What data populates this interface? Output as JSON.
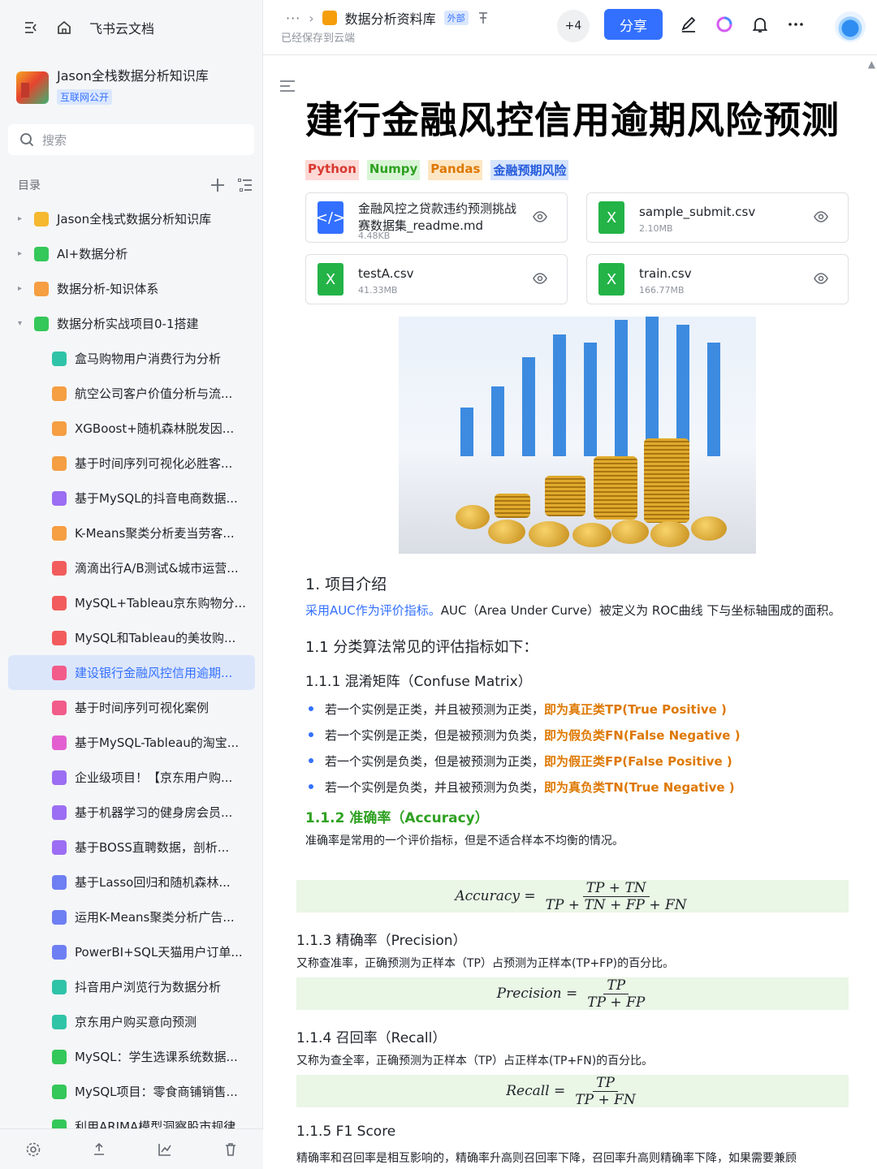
{
  "sidebar": {
    "brand": "飞书云文档",
    "space": {
      "name": "Jason全栈数据分析知识库",
      "tag": "互联网公开"
    },
    "search_placeholder": "搜索",
    "toc_label": "目录",
    "tree": [
      {
        "label": "Jason全栈式数据分析知识库",
        "level": 0,
        "icon_color": "#f5b82e",
        "expanded": false
      },
      {
        "label": "AI+数据分析",
        "level": 0,
        "icon_color": "#34c759",
        "expanded": false
      },
      {
        "label": "数据分析-知识体系",
        "level": 0,
        "icon_color": "#f59e42",
        "expanded": false
      },
      {
        "label": "数据分析实战项目0-1搭建",
        "level": 0,
        "icon_color": "#34c759",
        "expanded": true
      },
      {
        "label": "盒马购物用户消费行为分析",
        "level": 1,
        "icon_color": "#2fc3a8"
      },
      {
        "label": "航空公司客户价值分析与流...",
        "level": 1,
        "icon_color": "#f59e42"
      },
      {
        "label": "XGBoost+随机森林脱发因...",
        "level": 1,
        "icon_color": "#f59e42"
      },
      {
        "label": "基于时间序列可视化必胜客...",
        "level": 1,
        "icon_color": "#f59e42"
      },
      {
        "label": "基于MySQL的抖音电商数据...",
        "level": 1,
        "icon_color": "#9b6ef3"
      },
      {
        "label": "K-Means聚类分析麦当劳客...",
        "level": 1,
        "icon_color": "#f59e42"
      },
      {
        "label": "滴滴出行A/B测试&城市运营...",
        "level": 1,
        "icon_color": "#f25c5c"
      },
      {
        "label": "MySQL+Tableau京东购物分...",
        "level": 1,
        "icon_color": "#f25c5c"
      },
      {
        "label": "MySQL和Tableau的美妆购...",
        "level": 1,
        "icon_color": "#f25c5c"
      },
      {
        "label": "建设银行金融风控信用逾期...",
        "level": 1,
        "icon_color": "#f25c8a",
        "active": true
      },
      {
        "label": "基于时间序列可视化案例",
        "level": 1,
        "icon_color": "#f25c8a"
      },
      {
        "label": "基于MySQL-Tableau的淘宝...",
        "level": 1,
        "icon_color": "#e35fd0"
      },
      {
        "label": "企业级项目！【京东用户购...",
        "level": 1,
        "icon_color": "#9b6ef3"
      },
      {
        "label": "基于机器学习的健身房会员...",
        "level": 1,
        "icon_color": "#9b6ef3"
      },
      {
        "label": "基于BOSS直聘数据，剖析...",
        "level": 1,
        "icon_color": "#9b6ef3"
      },
      {
        "label": "基于Lasso回归和随机森林...",
        "level": 1,
        "icon_color": "#6e7ff3"
      },
      {
        "label": "运用K-Means聚类分析广告...",
        "level": 1,
        "icon_color": "#6e7ff3"
      },
      {
        "label": "PowerBI+SQL天猫用户订单...",
        "level": 1,
        "icon_color": "#6e7ff3"
      },
      {
        "label": "抖音用户浏览行为数据分析",
        "level": 1,
        "icon_color": "#2fc3a8"
      },
      {
        "label": "京东用户购买意向预测",
        "level": 1,
        "icon_color": "#2fc3a8"
      },
      {
        "label": "MySQL：学生选课系统数据...",
        "level": 1,
        "icon_color": "#34c759"
      },
      {
        "label": "MySQL项目：零食商铺销售...",
        "level": 1,
        "icon_color": "#34c759"
      },
      {
        "label": "利用ARIMA模型洞察股市规律",
        "level": 1,
        "icon_color": "#34c759"
      }
    ]
  },
  "header": {
    "breadcrumb_more": "···",
    "doc_title": "数据分析资料库",
    "external_tag": "外部",
    "saved_status": "已经保存到云端",
    "collaborators": "+4",
    "share_label": "分享"
  },
  "doc": {
    "title": "建行金融风控信用逾期风险预测",
    "tags": [
      {
        "label": "Python",
        "color": "#d83931",
        "bg": "#fdd9d6"
      },
      {
        "label": "Numpy",
        "color": "#2ea121",
        "bg": "#d9f5d6"
      },
      {
        "label": "Pandas",
        "color": "#de7802",
        "bg": "#fde6c4"
      },
      {
        "label": "金融预期风险",
        "color": "#245bdb",
        "bg": "#d6e4fd"
      }
    ],
    "files": [
      {
        "name": "金融风控之贷款违约预测挑战赛数据集_readme.md",
        "size": "4.48KB",
        "type": "code",
        "color": "#3370ff"
      },
      {
        "name": "sample_submit.csv",
        "size": "2.10MB",
        "type": "sheet",
        "color": "#23b347"
      },
      {
        "name": "testA.csv",
        "size": "41.33MB",
        "type": "sheet",
        "color": "#23b347"
      },
      {
        "name": "train.csv",
        "size": "166.77MB",
        "type": "sheet",
        "color": "#23b347"
      }
    ],
    "s1_title": "1. 项目介绍",
    "s1_link": "采用AUC作为评价指标。",
    "s1_text": "AUC（Area Under Curve）被定义为 ROC曲线 下与坐标轴围成的面积。",
    "s11_title": "1.1 分类算法常见的评估指标如下：",
    "s111_title": "1.1.1 混淆矩阵（Confuse Matrix）",
    "bullets": [
      {
        "text": "若一个实例是正类，并且被预测为正类，",
        "hl": "即为真正类TP(True Positive )"
      },
      {
        "text": "若一个实例是正类，但是被预测为负类，",
        "hl": "即为假负类FN(False Negative )"
      },
      {
        "text": "若一个实例是负类，但是被预测为正类，",
        "hl": "即为假正类FP(False Positive )"
      },
      {
        "text": "若一个实例是负类，并且被预测为负类，",
        "hl": "即为真负类TN(True Negative )"
      }
    ],
    "s112_title": "1.1.2 准确率（Accuracy）",
    "s112_text": "准确率是常用的一个评价指标，但是不适合样本不均衡的情况。",
    "f_acc": {
      "lhs": "Accuracy =",
      "num": "TP + TN",
      "den": "TP + TN + FP + FN"
    },
    "s113_title": "1.1.3 精确率（Precision）",
    "s113_text": "又称查准率，正确预测为正样本（TP）占预测为正样本(TP+FP)的百分比。",
    "f_prec": {
      "lhs": "Precision =",
      "num": "TP",
      "den": "TP + FP"
    },
    "s114_title": "1.1.4 召回率（Recall）",
    "s114_text": "又称为查全率，正确预测为正样本（TP）占正样本(TP+FN)的百分比。",
    "f_rec": {
      "lhs": "Recall =",
      "num": "TP",
      "den": "TP + FN"
    },
    "s115_title": "1.1.5 F1 Score",
    "s115_text": "精确率和召回率是相互影响的，精确率升高则召回率下降，召回率升高则精确率下降，如果需要兼顾"
  }
}
